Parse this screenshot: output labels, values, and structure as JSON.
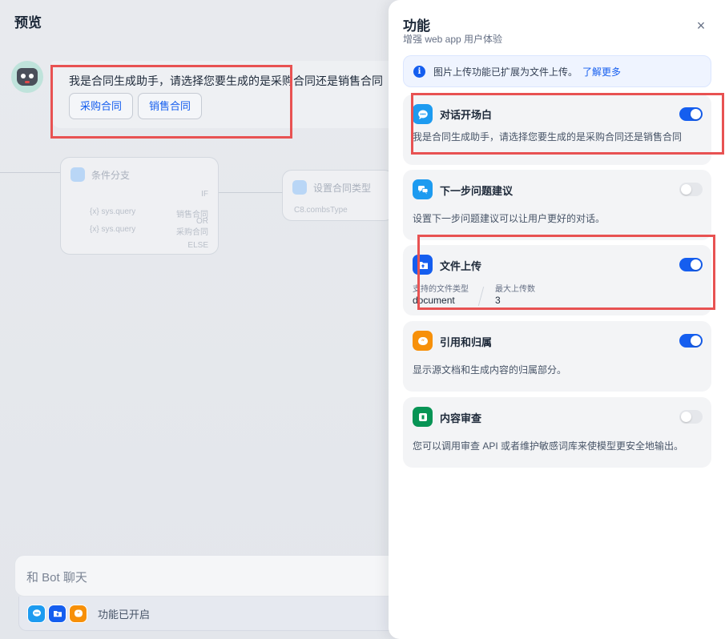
{
  "preview": {
    "title": "预览",
    "bot_message": "我是合同生成助手，请选择您要生成的是采购合同还是销售合同",
    "options": [
      "采购合同",
      "销售合同"
    ],
    "chat_placeholder": "和 Bot 聊天",
    "features_enabled_label": "功能已开启"
  },
  "workflow_bg": {
    "node1_title": "条件分支",
    "node1_if": "IF",
    "node1_row1_var": "{x} sys.query",
    "node1_row1_val": "销售合同",
    "node1_or": "OR",
    "node1_row2_var": "{x} sys.query",
    "node1_row2_val": "采购合同",
    "node1_else": "ELSE",
    "node2_title": "设置合同类型",
    "node2_value": "C8.combsType"
  },
  "panel": {
    "title": "功能",
    "subtitle": "增强 web app 用户体验",
    "close_symbol": "×",
    "info_text": "图片上传功能已扩展为文件上传。",
    "info_link": "了解更多",
    "features": {
      "opening": {
        "title": "对话开场白",
        "desc": "我是合同生成助手，请选择您要生成的是采购合同还是销售合同",
        "enabled": true,
        "color": "#1d9bf0"
      },
      "suggest": {
        "title": "下一步问题建议",
        "desc": "设置下一步问题建议可以让用户更好的对话。",
        "enabled": false,
        "color": "#1d9bf0"
      },
      "upload": {
        "title": "文件上传",
        "type_label": "支持的文件类型",
        "type_value": "document",
        "max_label": "最大上传数",
        "max_value": "3",
        "enabled": true,
        "color": "#155eef"
      },
      "citation": {
        "title": "引用和归属",
        "desc": "显示源文档和生成内容的归属部分。",
        "enabled": true,
        "color": "#f79009"
      },
      "moderation": {
        "title": "内容审查",
        "desc": "您可以调用审查 API 或者维护敏感词库来使模型更安全地输出。",
        "enabled": false,
        "color": "#079455"
      }
    }
  },
  "colors": {
    "accent": "#155eef",
    "highlight": "#e85252"
  }
}
